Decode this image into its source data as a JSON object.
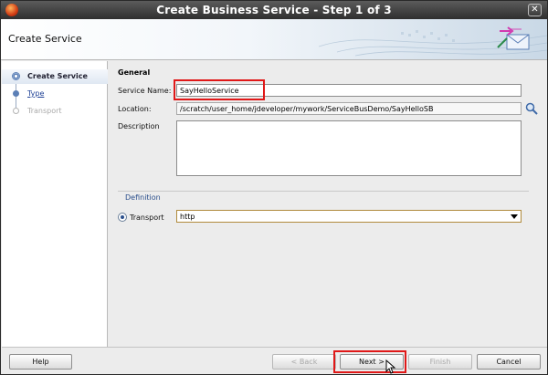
{
  "window": {
    "title": "Create Business Service - Step 1 of 3",
    "close_glyph": "✕"
  },
  "header": {
    "heading": "Create Service"
  },
  "nav": {
    "items": [
      {
        "label": "Create Service",
        "state": "active"
      },
      {
        "label": "Type",
        "state": "link"
      },
      {
        "label": "Transport",
        "state": "disabled"
      }
    ]
  },
  "form": {
    "general_title": "General",
    "service_name": {
      "label": "Service Name:",
      "value": "SayHelloService"
    },
    "location": {
      "label": "Location:",
      "value": "/scratch/user_home/jdeveloper/mywork/ServiceBusDemo/SayHelloSB"
    },
    "description": {
      "label": "Description",
      "value": ""
    },
    "definition_title": "Definition",
    "transport": {
      "label": "Transport",
      "value": "http",
      "selected": true
    }
  },
  "footer": {
    "help": "Help",
    "back": "< Back",
    "next": "Next >",
    "finish": "Finish",
    "cancel": "Cancel"
  },
  "colors": {
    "highlight": "#e01818",
    "link": "#1c3f94",
    "titlebar": "#3a3a3a"
  }
}
